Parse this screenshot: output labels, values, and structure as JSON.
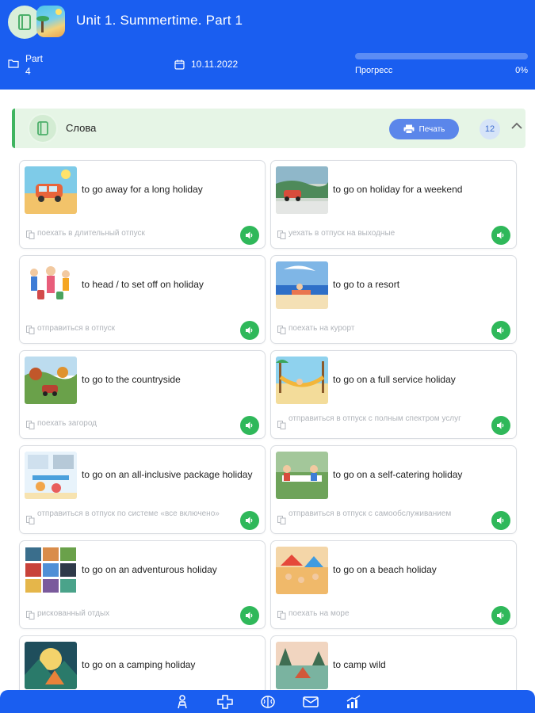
{
  "header": {
    "title": "Unit 1. Summertime. Part 1",
    "part_label": "Part",
    "part_value": "4",
    "date": "10.11.2022",
    "progress_label": "Прогресс",
    "progress_text": "0%",
    "progress_fraction": 0
  },
  "section": {
    "title": "Слова",
    "print_label": "Печать",
    "count": "12"
  },
  "cards": [
    {
      "en": "to go away for a long holiday",
      "ru": "поехать в длительный отпуск",
      "img": "van-beach"
    },
    {
      "en": "to go on holiday for a weekend",
      "ru": "уехать в отпуск на выходные",
      "img": "car-coast"
    },
    {
      "en": "to head / to set off on holiday",
      "ru": "отправиться в отпуск",
      "img": "family-luggage"
    },
    {
      "en": "to go to a resort",
      "ru": "поехать на курорт",
      "img": "resort-sea"
    },
    {
      "en": "to go to the countryside",
      "ru": "поехать загород",
      "img": "countryside"
    },
    {
      "en": "to go on a full service holiday",
      "ru": "отправиться в отпуск с полным спектром услуг",
      "img": "hammock"
    },
    {
      "en": "to go on an all-inclusive package holiday",
      "ru": "отправиться в отпуск по системе «все включено»",
      "img": "all-inclusive"
    },
    {
      "en": "to go on a self-catering holiday",
      "ru": "отправиться в отпуск с самообслуживанием",
      "img": "picnic"
    },
    {
      "en": "to go on an adventurous holiday",
      "ru": "рискованный отдых",
      "img": "collage"
    },
    {
      "en": "to go on a beach holiday",
      "ru": "поехать на море",
      "img": "beach-crowd"
    },
    {
      "en": "to go on a camping holiday",
      "ru": "",
      "img": "camping"
    },
    {
      "en": "to camp wild",
      "ru": "",
      "img": "camp-wild"
    }
  ],
  "icons": {
    "header": "book-icon",
    "part": "folder-icon",
    "date": "calendar-icon",
    "section": "book-icon",
    "print": "printer-icon",
    "collapse": "chevron-up-icon",
    "translation": "translate-icon",
    "audio": "speaker-icon"
  },
  "bottom_nav": [
    {
      "name": "nav-home-icon"
    },
    {
      "name": "nav-game-icon"
    },
    {
      "name": "nav-brain-icon"
    },
    {
      "name": "nav-messages-icon"
    },
    {
      "name": "nav-stats-icon"
    }
  ],
  "colors": {
    "primary": "#1a5ef0",
    "accent_green": "#2fb85a",
    "section_bg": "#e6f5e6",
    "print_button": "#5b86ea"
  }
}
